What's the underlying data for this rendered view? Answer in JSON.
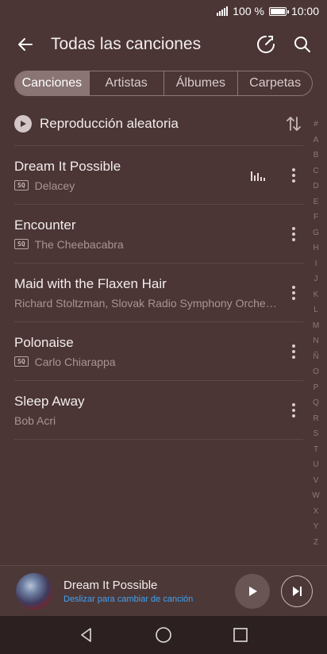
{
  "status": {
    "battery_text": "100 %",
    "time": "10:00"
  },
  "app_bar": {
    "title": "Todas las canciones",
    "icons": [
      "back-arrow-icon",
      "sleep-timer-icon",
      "search-icon"
    ]
  },
  "tabs": [
    {
      "label": "Canciones",
      "active": true
    },
    {
      "label": "Artistas",
      "active": false
    },
    {
      "label": "Álbumes",
      "active": false
    },
    {
      "label": "Carpetas",
      "active": false
    }
  ],
  "shuffle": {
    "label": "Reproducción aleatoria"
  },
  "songs": [
    {
      "title": "Dream It Possible",
      "artist": "Delacey",
      "sq": true,
      "playing": true
    },
    {
      "title": "Encounter",
      "artist": "The Cheebacabra",
      "sq": true,
      "playing": false
    },
    {
      "title": "Maid with the Flaxen Hair",
      "artist": "Richard Stoltzman, Slovak Radio Symphony Orche…",
      "sq": false,
      "playing": false
    },
    {
      "title": "Polonaise",
      "artist": "Carlo Chiarappa",
      "sq": true,
      "playing": false
    },
    {
      "title": "Sleep Away",
      "artist": "Bob Acri",
      "sq": false,
      "playing": false
    }
  ],
  "sq_badge": "SQ",
  "index_letters": [
    "#",
    "A",
    "B",
    "C",
    "D",
    "E",
    "F",
    "G",
    "H",
    "I",
    "J",
    "K",
    "L",
    "M",
    "N",
    "Ñ",
    "O",
    "P",
    "Q",
    "R",
    "S",
    "T",
    "U",
    "V",
    "W",
    "X",
    "Y",
    "Z"
  ],
  "now_playing": {
    "title": "Dream It Possible",
    "hint": "Deslizar para cambiar de canción"
  },
  "colors": {
    "background": "#4b3535",
    "accent_hint": "#3da3f5",
    "nav_bar": "#2d2020"
  }
}
